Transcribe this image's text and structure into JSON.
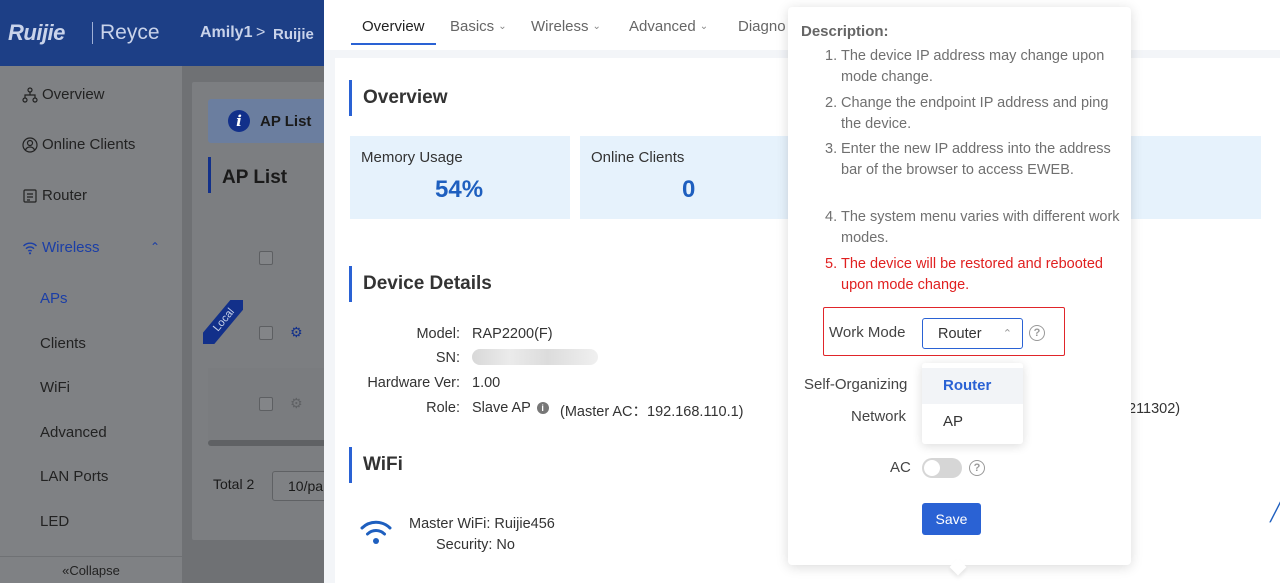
{
  "header": {
    "logo": "Ruijie",
    "brand2": "Reyce",
    "breadcrumb_user": "Amily1",
    "breadcrumb_arrow": ">",
    "breadcrumb_site": "Ruijie"
  },
  "sidebar": {
    "items": [
      {
        "label": "Overview",
        "icon": "topology-icon"
      },
      {
        "label": "Online Clients",
        "icon": "user-icon"
      },
      {
        "label": "Router",
        "icon": "router-icon"
      },
      {
        "label": "Wireless",
        "icon": "wifi-icon"
      }
    ],
    "sub_items": [
      "APs",
      "Clients",
      "WiFi",
      "Advanced",
      "LAN Ports",
      "LED"
    ],
    "collapse": "Collapse"
  },
  "ap_list": {
    "tab_label": "AP List",
    "title": "AP List",
    "local_tag": "Local",
    "total": "Total 2",
    "per_page": "10/pa"
  },
  "drawer": {
    "tabs": [
      {
        "label": "Overview",
        "active": true
      },
      {
        "label": "Basics",
        "has_caret": true
      },
      {
        "label": "Wireless",
        "has_caret": true
      },
      {
        "label": "Advanced",
        "has_caret": true
      },
      {
        "label": "Diagno"
      }
    ],
    "overview_title": "Overview",
    "stats": [
      {
        "label": "Memory Usage",
        "value": "54%"
      },
      {
        "label": "Online Clients",
        "value": "0"
      }
    ],
    "device_details_title": "Device Details",
    "details": {
      "model_key": "Model:",
      "model_val": "RAP2200(F)",
      "sn_key": "SN:",
      "hw_key": "Hardware Ver:",
      "hw_val": "1.00",
      "role_key": "Role:",
      "role_val": "Slave AP",
      "role_extra": "(Master AC：192.168.110.1)"
    },
    "right_fragment": "211302)",
    "wifi_title": "WiFi",
    "master_wifi": "Master WiFi: Ruijie456",
    "security": "Security: No"
  },
  "popover": {
    "desc_title": "Description:",
    "desc_items": [
      {
        "n": "1.",
        "text": "The device IP address may change upon mode change."
      },
      {
        "n": "2.",
        "text": "Change the endpoint IP address and ping the device."
      },
      {
        "n": "3.",
        "text": "Enter the new IP address into the address bar of the browser to access EWEB."
      },
      {
        "n": "4.",
        "text": "The system menu varies with different work modes."
      },
      {
        "n": "5.",
        "text": "The device will be restored and rebooted upon mode change."
      }
    ],
    "work_mode_label": "Work Mode",
    "work_mode_value": "Router",
    "options": [
      "Router",
      "AP"
    ],
    "self_org_label_1": "Self-Organizing",
    "self_org_label_2": "Network",
    "ac_label": "AC",
    "ac_enabled": false,
    "save": "Save"
  },
  "colors": {
    "primary": "#2a62d4",
    "warning": "#e02020",
    "nav": "#1d3f86"
  }
}
